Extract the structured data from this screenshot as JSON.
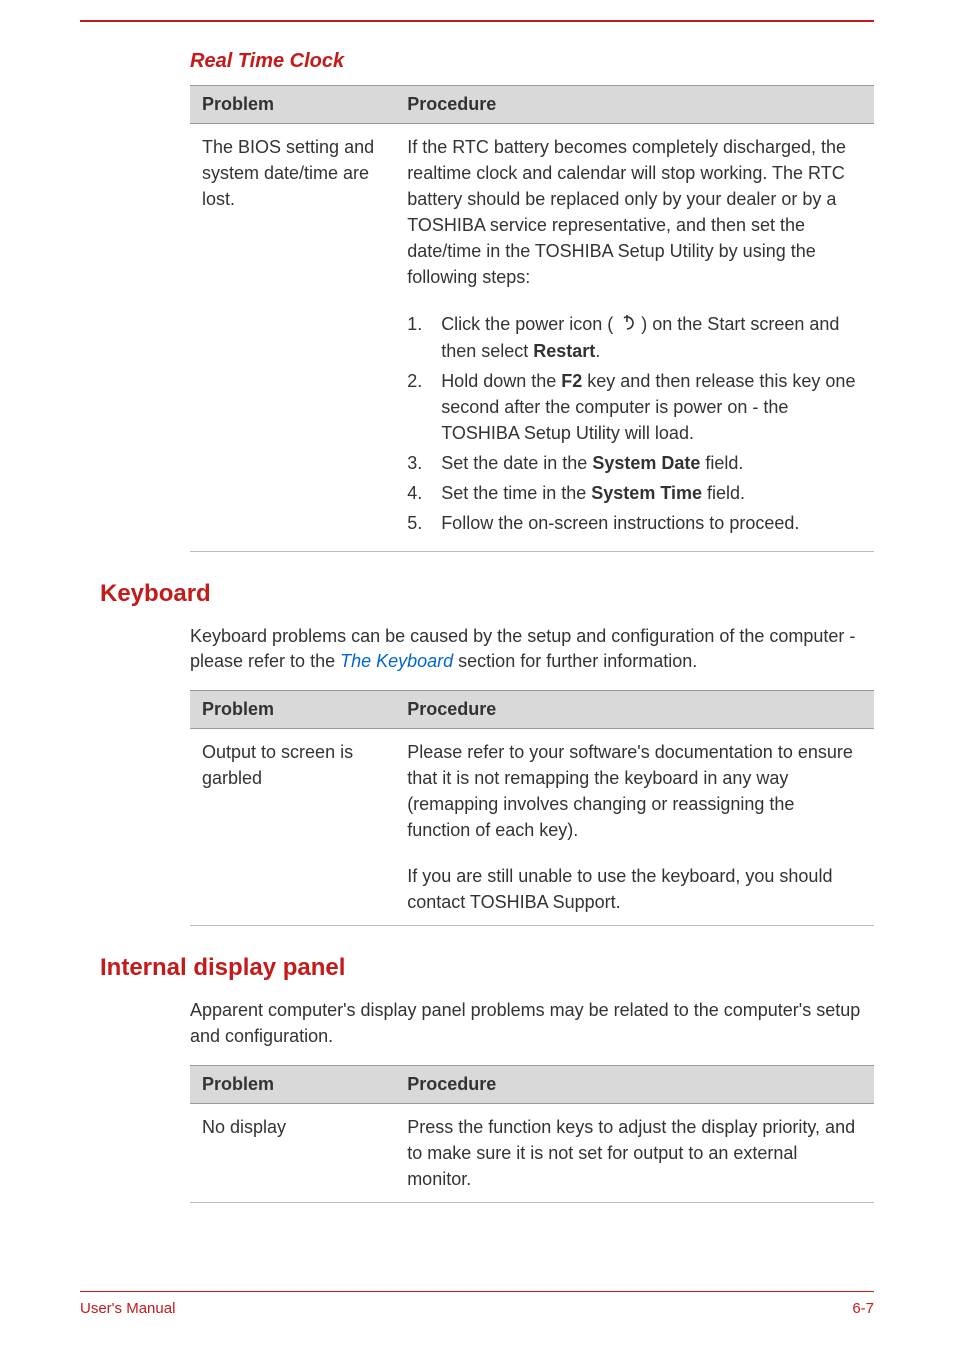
{
  "rtc": {
    "heading": "Real Time Clock",
    "col_problem": "Problem",
    "col_procedure": "Procedure",
    "problem": "The BIOS setting and system date/time are lost.",
    "procedure_intro": "If the RTC battery becomes completely discharged, the realtime clock and calendar will stop working. The RTC battery should be replaced only by your dealer or by a TOSHIBA service representative, and then set the date/time in the TOSHIBA Setup Utility by using the following steps:",
    "steps": {
      "s1a": "Click the power icon ( ",
      "s1b": " ) on the Start screen and then select ",
      "s1c": "Restart",
      "s1d": ".",
      "s2a": "Hold down the ",
      "s2b": "F2",
      "s2c": " key and then release this key one second after the computer is power on - the TOSHIBA Setup Utility will load.",
      "s3a": "Set the date in the ",
      "s3b": "System Date",
      "s3c": " field.",
      "s4a": "Set the time in the ",
      "s4b": "System Time",
      "s4c": " field.",
      "s5": "Follow the on-screen instructions to proceed."
    }
  },
  "keyboard": {
    "heading": "Keyboard",
    "intro_a": "Keyboard problems can be caused by the setup and configuration of the computer - please refer to the ",
    "intro_link": "The Keyboard",
    "intro_b": " section for further information.",
    "col_problem": "Problem",
    "col_procedure": "Procedure",
    "problem": "Output to screen is garbled",
    "procedure1": "Please refer to your software's documentation to ensure that it is not remapping the keyboard in any way (remapping involves changing or reassigning the function of each key).",
    "procedure2": "If you are still unable to use the keyboard, you should contact TOSHIBA Support."
  },
  "display": {
    "heading": "Internal display panel",
    "intro": "Apparent computer's display panel problems may be related to the computer's setup and configuration.",
    "col_problem": "Problem",
    "col_procedure": "Procedure",
    "problem": "No display",
    "procedure": "Press the function keys to adjust the display priority, and to make sure it is not set for output to an external monitor."
  },
  "footer": {
    "left": "User's Manual",
    "right": "6-7"
  },
  "nums": {
    "n1": "1.",
    "n2": "2.",
    "n3": "3.",
    "n4": "4.",
    "n5": "5."
  }
}
